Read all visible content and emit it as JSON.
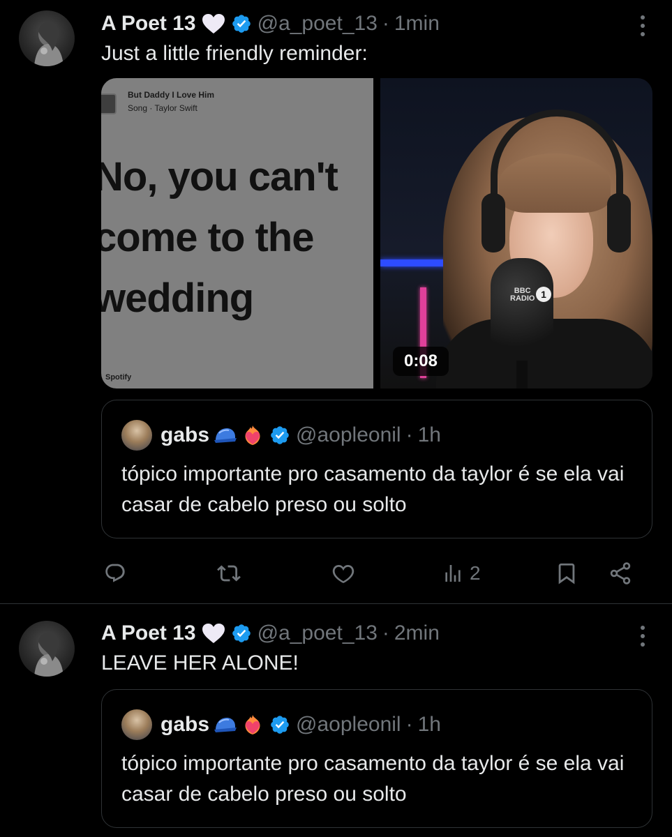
{
  "tweets": [
    {
      "author": {
        "name": "A Poet 13",
        "handle": "@a_poet_13"
      },
      "time": "1min",
      "text": "Just a little friendly reminder:",
      "media": {
        "lyric_card": {
          "song_title": "But Daddy I Love Him",
          "song_subtitle": "Song · Taylor Swift",
          "lyric": "No, you can't\ncome to the\nwedding",
          "source": "Spotify"
        },
        "video": {
          "duration": "0:08",
          "mic_logo": "BBC\nRADIO",
          "mic_number": "1"
        }
      },
      "quote": {
        "author": {
          "name": "gabs",
          "handle": "@aopleonil"
        },
        "time": "1h",
        "text": "tópico importante pro casamento da taylor é se ela vai casar de cabelo preso ou solto"
      },
      "actions": {
        "views": "2"
      }
    },
    {
      "author": {
        "name": "A Poet 13",
        "handle": "@a_poet_13"
      },
      "time": "2min",
      "text": "LEAVE HER ALONE!",
      "quote": {
        "author": {
          "name": "gabs",
          "handle": "@aopleonil"
        },
        "time": "1h",
        "text": "tópico importante pro casamento da taylor é se ela vai casar de cabelo preso ou solto"
      }
    }
  ],
  "separator": "·",
  "colors": {
    "background": "#000000",
    "text": "#e7e9ea",
    "muted": "#71767b",
    "border": "#2f3336",
    "verified": "#1d9bf0"
  }
}
